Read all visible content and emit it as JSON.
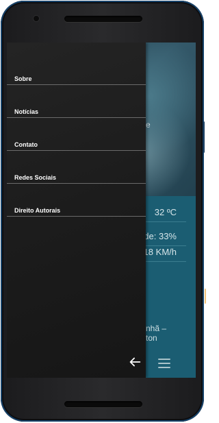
{
  "drawer": {
    "items": [
      {
        "label": "Sobre"
      },
      {
        "label": "Notícias"
      },
      {
        "label": "Contato"
      },
      {
        "label": "Redes Sociais"
      },
      {
        "label": "Direito Autorais"
      }
    ]
  },
  "background": {
    "hero_text": "e",
    "temperature": "32 ºC",
    "humidity": "ade: 33%",
    "wind": "18 KM/h",
    "forecast_line1": "nhã –",
    "forecast_line2": "ton"
  },
  "icons": {
    "back": "arrow-left-icon",
    "menu": "hamburger-menu-icon"
  },
  "colors": {
    "drawer_bg": "#1c1c1c",
    "screen_bg": "#1b5d72",
    "frame_accent": "#16426a"
  }
}
